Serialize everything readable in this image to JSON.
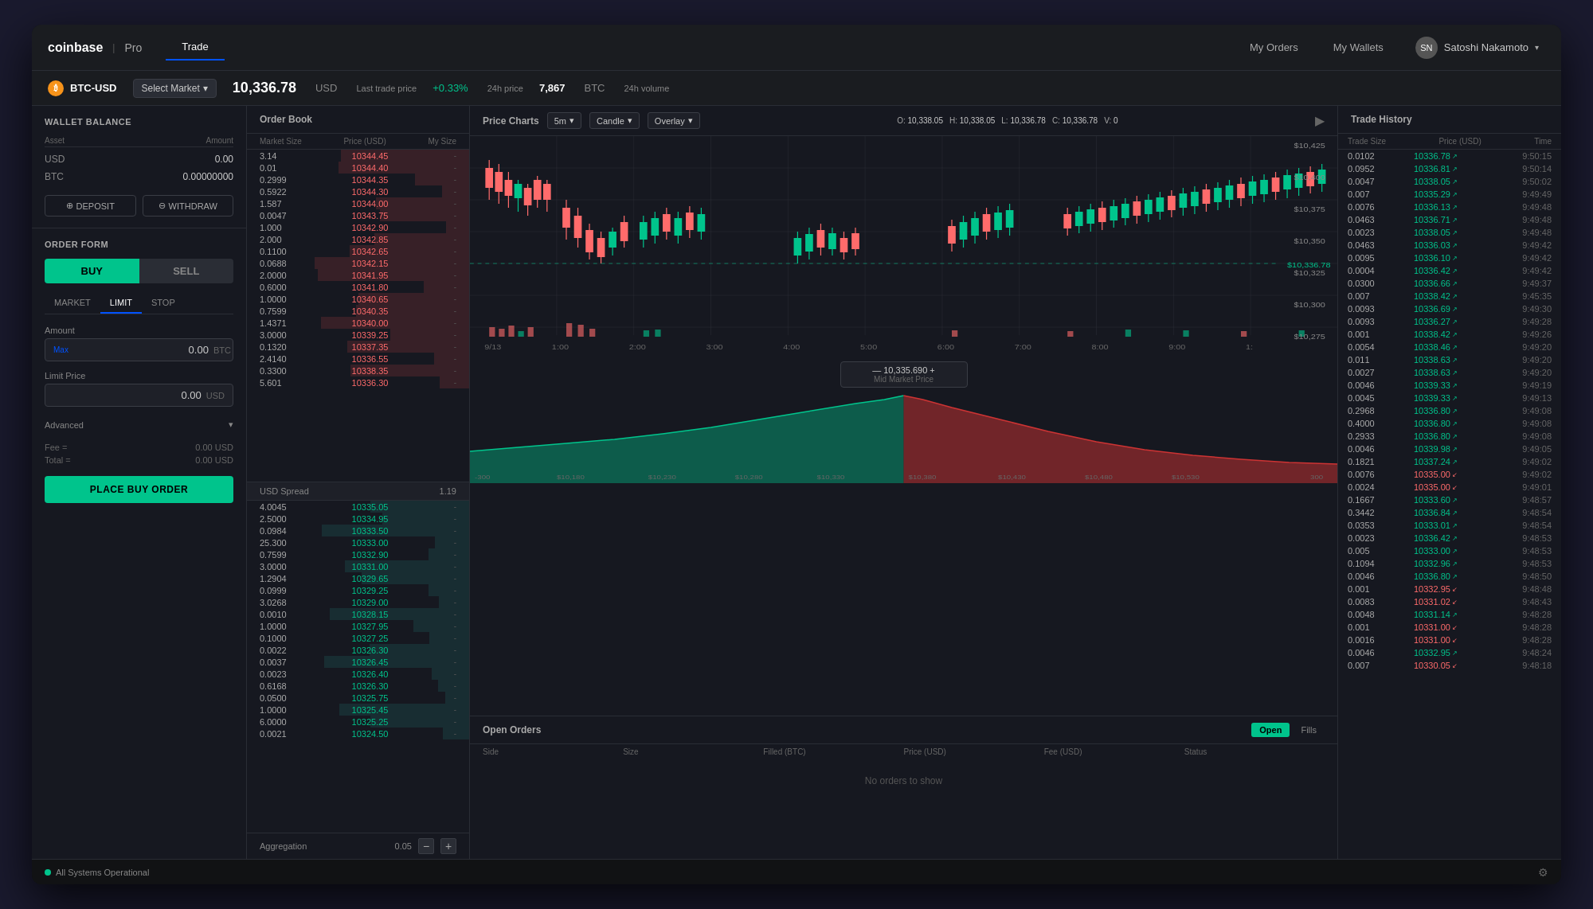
{
  "app": {
    "title": "coinbase",
    "subtitle": "Pro"
  },
  "nav": {
    "active_tab": "Trade",
    "tabs": [
      "Trade"
    ],
    "my_orders": "My Orders",
    "my_wallets": "My Wallets",
    "user_name": "Satoshi Nakamoto"
  },
  "market": {
    "pair": "BTC-USD",
    "select_label": "Select Market",
    "price": "10,336.78",
    "currency": "USD",
    "last_trade_label": "Last trade price",
    "change": "+0.33%",
    "change_label": "24h price",
    "volume": "7,867",
    "volume_currency": "BTC",
    "volume_label": "24h volume"
  },
  "wallet": {
    "title": "Wallet Balance",
    "asset_col": "Asset",
    "amount_col": "Amount",
    "usd_label": "USD",
    "usd_amount": "0.00",
    "btc_label": "BTC",
    "btc_amount": "0.00000000",
    "deposit_btn": "DEPOSIT",
    "withdraw_btn": "WITHDRAW"
  },
  "order_form": {
    "title": "Order Form",
    "buy_btn": "BUY",
    "sell_btn": "SELL",
    "types": [
      "MARKET",
      "LIMIT",
      "STOP"
    ],
    "active_type": "LIMIT",
    "amount_label": "Amount",
    "max_label": "Max",
    "amount_value": "0.00",
    "amount_unit": "BTC",
    "limit_price_label": "Limit Price",
    "limit_price_value": "0.00",
    "limit_price_unit": "USD",
    "advanced_label": "Advanced",
    "fee_label": "Fee =",
    "fee_value": "0.00 USD",
    "total_label": "Total =",
    "total_value": "0.00 USD",
    "place_order_btn": "PLACE BUY ORDER"
  },
  "order_book": {
    "title": "Order Book",
    "col_market_size": "Market Size",
    "col_price_usd": "Price (USD)",
    "col_my_size": "My Size",
    "spread_label": "USD Spread",
    "spread_value": "1.19",
    "aggregation_label": "Aggregation",
    "aggregation_value": "0.05",
    "asks": [
      {
        "size": "3.14",
        "price": "10344.45"
      },
      {
        "size": "0.01",
        "price": "10344.40"
      },
      {
        "size": "0.2999",
        "price": "10344.35"
      },
      {
        "size": "0.5922",
        "price": "10344.30"
      },
      {
        "size": "1.587",
        "price": "10344.00"
      },
      {
        "size": "0.0047",
        "price": "10343.75"
      },
      {
        "size": "1.000",
        "price": "10342.90"
      },
      {
        "size": "2.000",
        "price": "10342.85"
      },
      {
        "size": "0.1100",
        "price": "10342.65"
      },
      {
        "size": "0.0688",
        "price": "10342.15"
      },
      {
        "size": "2.0000",
        "price": "10341.95"
      },
      {
        "size": "0.6000",
        "price": "10341.80"
      },
      {
        "size": "1.0000",
        "price": "10340.65"
      },
      {
        "size": "0.7599",
        "price": "10340.35"
      },
      {
        "size": "1.4371",
        "price": "10340.00"
      },
      {
        "size": "3.0000",
        "price": "10339.25"
      },
      {
        "size": "0.1320",
        "price": "10337.35"
      },
      {
        "size": "2.4140",
        "price": "10336.55"
      },
      {
        "size": "0.3300",
        "price": "10338.35"
      },
      {
        "size": "5.601",
        "price": "10336.30"
      }
    ],
    "bids": [
      {
        "size": "4.0045",
        "price": "10335.05"
      },
      {
        "size": "2.5000",
        "price": "10334.95"
      },
      {
        "size": "0.0984",
        "price": "10333.50"
      },
      {
        "size": "25.300",
        "price": "10333.00"
      },
      {
        "size": "0.7599",
        "price": "10332.90"
      },
      {
        "size": "3.0000",
        "price": "10331.00"
      },
      {
        "size": "1.2904",
        "price": "10329.65"
      },
      {
        "size": "0.0999",
        "price": "10329.25"
      },
      {
        "size": "3.0268",
        "price": "10329.00"
      },
      {
        "size": "0.0010",
        "price": "10328.15"
      },
      {
        "size": "1.0000",
        "price": "10327.95"
      },
      {
        "size": "0.1000",
        "price": "10327.25"
      },
      {
        "size": "0.0022",
        "price": "10326.30"
      },
      {
        "size": "0.0037",
        "price": "10326.45"
      },
      {
        "size": "0.0023",
        "price": "10326.40"
      },
      {
        "size": "0.6168",
        "price": "10326.30"
      },
      {
        "size": "0.0500",
        "price": "10325.75"
      },
      {
        "size": "1.0000",
        "price": "10325.45"
      },
      {
        "size": "6.0000",
        "price": "10325.25"
      },
      {
        "size": "0.0021",
        "price": "10324.50"
      }
    ]
  },
  "chart": {
    "title": "Price Charts",
    "timeframe": "5m",
    "chart_type": "Candle",
    "overlay_label": "Overlay",
    "ohlcv": {
      "o_label": "O:",
      "o_val": "10,338.05",
      "h_label": "H:",
      "h_val": "10,338.05",
      "l_label": "L:",
      "l_val": "10,336.78",
      "c_label": "C:",
      "c_val": "10,336.78",
      "v_label": "V:",
      "v_val": "0"
    },
    "price_label": "$10,336.78",
    "mid_price": "10,335.690",
    "mid_price_label": "Mid Market Price",
    "y_labels": [
      "$10,425",
      "$10,400",
      "$10,375",
      "$10,350",
      "$10,325",
      "$10,300",
      "$10,275"
    ],
    "x_labels": [
      "9/13",
      "1:00",
      "2:00",
      "3:00",
      "4:00",
      "5:00",
      "6:00",
      "7:00",
      "8:00",
      "9:00",
      "1:"
    ],
    "depth_labels": [
      "-300",
      "$10,180",
      "$10,230",
      "$10,280",
      "$10,330",
      "$10,380",
      "$10,430",
      "$10,480",
      "$10,530",
      "300"
    ]
  },
  "open_orders": {
    "title": "Open Orders",
    "open_btn": "Open",
    "fills_btn": "Fills",
    "col_side": "Side",
    "col_size": "Size",
    "col_filled": "Filled (BTC)",
    "col_price": "Price (USD)",
    "col_fee": "Fee (USD)",
    "col_status": "Status",
    "no_orders_text": "No orders to show"
  },
  "trade_history": {
    "title": "Trade History",
    "col_trade_size": "Trade Size",
    "col_price_usd": "Price (USD)",
    "col_time": "Time",
    "trades": [
      {
        "size": "0.0102",
        "price": "10336.78",
        "dir": "up",
        "time": "9:50:15"
      },
      {
        "size": "0.0952",
        "price": "10336.81",
        "dir": "up",
        "time": "9:50:14"
      },
      {
        "size": "0.0047",
        "price": "10338.05",
        "dir": "up",
        "time": "9:50:02"
      },
      {
        "size": "0.007",
        "price": "10335.29",
        "dir": "up",
        "time": "9:49:49"
      },
      {
        "size": "0.0076",
        "price": "10336.13",
        "dir": "up",
        "time": "9:49:48"
      },
      {
        "size": "0.0463",
        "price": "10336.71",
        "dir": "up",
        "time": "9:49:48"
      },
      {
        "size": "0.0023",
        "price": "10338.05",
        "dir": "up",
        "time": "9:49:48"
      },
      {
        "size": "0.0463",
        "price": "10336.03",
        "dir": "up",
        "time": "9:49:42"
      },
      {
        "size": "0.0095",
        "price": "10336.10",
        "dir": "up",
        "time": "9:49:42"
      },
      {
        "size": "0.0004",
        "price": "10336.42",
        "dir": "up",
        "time": "9:49:42"
      },
      {
        "size": "0.0300",
        "price": "10336.66",
        "dir": "up",
        "time": "9:49:37"
      },
      {
        "size": "0.007",
        "price": "10338.42",
        "dir": "up",
        "time": "9:45:35"
      },
      {
        "size": "0.0093",
        "price": "10336.69",
        "dir": "up",
        "time": "9:49:30"
      },
      {
        "size": "0.0093",
        "price": "10336.27",
        "dir": "up",
        "time": "9:49:28"
      },
      {
        "size": "0.001",
        "price": "10338.42",
        "dir": "up",
        "time": "9:49:26"
      },
      {
        "size": "0.0054",
        "price": "10338.46",
        "dir": "up",
        "time": "9:49:20"
      },
      {
        "size": "0.011",
        "price": "10338.63",
        "dir": "up",
        "time": "9:49:20"
      },
      {
        "size": "0.0027",
        "price": "10338.63",
        "dir": "up",
        "time": "9:49:20"
      },
      {
        "size": "0.0046",
        "price": "10339.33",
        "dir": "up",
        "time": "9:49:19"
      },
      {
        "size": "0.0045",
        "price": "10339.33",
        "dir": "up",
        "time": "9:49:13"
      },
      {
        "size": "0.2968",
        "price": "10336.80",
        "dir": "up",
        "time": "9:49:08"
      },
      {
        "size": "0.4000",
        "price": "10336.80",
        "dir": "up",
        "time": "9:49:08"
      },
      {
        "size": "0.2933",
        "price": "10336.80",
        "dir": "up",
        "time": "9:49:08"
      },
      {
        "size": "0.0046",
        "price": "10339.98",
        "dir": "up",
        "time": "9:49:05"
      },
      {
        "size": "0.1821",
        "price": "10337.24",
        "dir": "up",
        "time": "9:49:02"
      },
      {
        "size": "0.0076",
        "price": "10335.00",
        "dir": "down",
        "time": "9:49:02"
      },
      {
        "size": "0.0024",
        "price": "10335.00",
        "dir": "down",
        "time": "9:49:01"
      },
      {
        "size": "0.1667",
        "price": "10333.60",
        "dir": "up",
        "time": "9:48:57"
      },
      {
        "size": "0.3442",
        "price": "10336.84",
        "dir": "up",
        "time": "9:48:54"
      },
      {
        "size": "0.0353",
        "price": "10333.01",
        "dir": "up",
        "time": "9:48:54"
      },
      {
        "size": "0.0023",
        "price": "10336.42",
        "dir": "up",
        "time": "9:48:53"
      },
      {
        "size": "0.005",
        "price": "10333.00",
        "dir": "up",
        "time": "9:48:53"
      },
      {
        "size": "0.1094",
        "price": "10332.96",
        "dir": "up",
        "time": "9:48:53"
      },
      {
        "size": "0.0046",
        "price": "10336.80",
        "dir": "up",
        "time": "9:48:50"
      },
      {
        "size": "0.001",
        "price": "10332.95",
        "dir": "down",
        "time": "9:48:48"
      },
      {
        "size": "0.0083",
        "price": "10331.02",
        "dir": "down",
        "time": "9:48:43"
      },
      {
        "size": "0.0048",
        "price": "10331.14",
        "dir": "up",
        "time": "9:48:28"
      },
      {
        "size": "0.001",
        "price": "10331.00",
        "dir": "down",
        "time": "9:48:28"
      },
      {
        "size": "0.0016",
        "price": "10331.00",
        "dir": "down",
        "time": "9:48:28"
      },
      {
        "size": "0.0046",
        "price": "10332.95",
        "dir": "up",
        "time": "9:48:24"
      },
      {
        "size": "0.007",
        "price": "10330.05",
        "dir": "down",
        "time": "9:48:18"
      }
    ]
  },
  "status_bar": {
    "operational_text": "All Systems Operational"
  }
}
